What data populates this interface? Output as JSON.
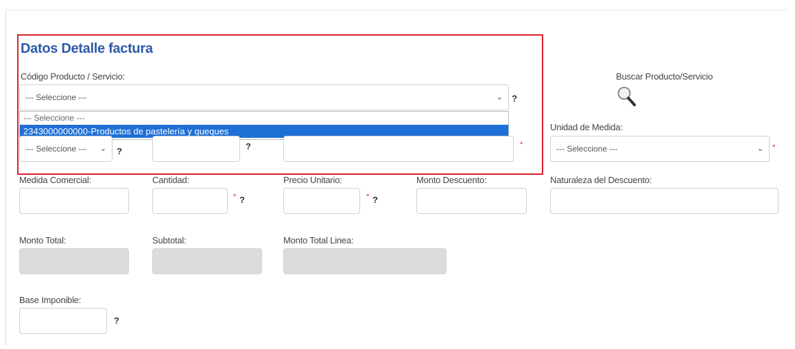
{
  "section": {
    "title": "Datos Detalle factura"
  },
  "codigo": {
    "label": "Código Producto / Servicio:",
    "selected": "--- Seleccione ---",
    "help": "?",
    "options": [
      "--- Seleccione ---",
      "2343000000000-Productos de pastelería y queques"
    ]
  },
  "buscar": {
    "label": "Buscar Producto/Servicio"
  },
  "row2": {
    "tipo_select": "--- Seleccione ---",
    "tipo_help": "?",
    "field2_help": "?",
    "field3_required": "*"
  },
  "unidad": {
    "label": "Unidad de Medida:",
    "selected": "--- Seleccione ---",
    "required": "*"
  },
  "medida_comercial": {
    "label": "Medida Comercial:"
  },
  "cantidad": {
    "label": "Cantidad:",
    "required": "*",
    "help": "?"
  },
  "precio_unitario": {
    "label": "Precio Unitario:",
    "required": "*",
    "help": "?"
  },
  "monto_descuento": {
    "label": "Monto Descuento:"
  },
  "naturaleza_descuento": {
    "label": "Naturaleza del Descuento:"
  },
  "monto_total": {
    "label": "Monto Total:"
  },
  "subtotal": {
    "label": "Subtotal:"
  },
  "monto_total_linea": {
    "label": "Monto Total Linea:"
  },
  "base_imponible": {
    "label": "Base Imponible:",
    "help": "?"
  },
  "colors": {
    "accent": "#2d5aa8",
    "highlight": "#d8222a",
    "selection": "#1e6fd6",
    "required": "#e0262d"
  }
}
